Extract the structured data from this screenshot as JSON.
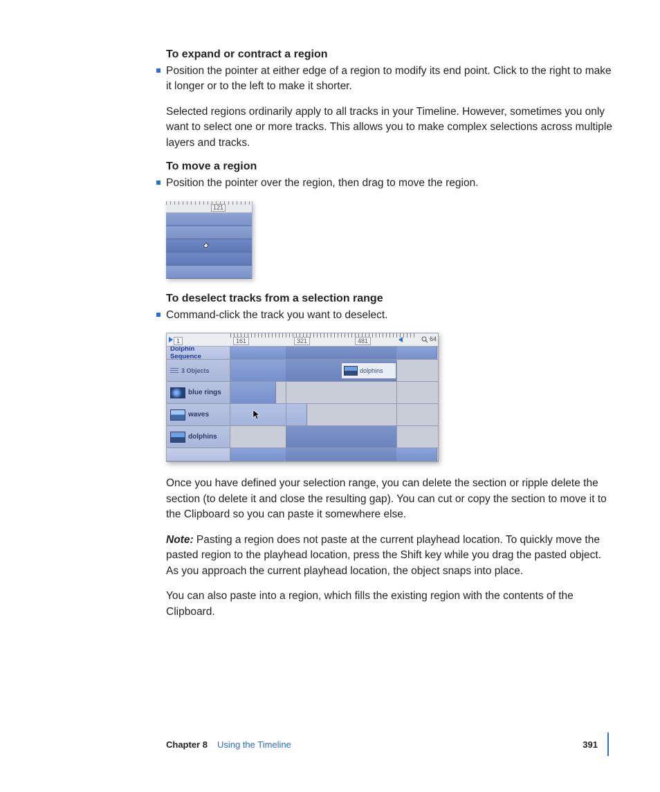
{
  "section1": {
    "heading": "To expand or contract a region",
    "bullet": "Position the pointer at either edge of a region to modify its end point. Click to the right to make it longer or to the left to make it shorter.",
    "para": "Selected regions ordinarily apply to all tracks in your Timeline. However, sometimes you only want to select one or more tracks. This allows you to make complex selections across multiple layers and tracks."
  },
  "section2": {
    "heading": "To move a region",
    "bullet": "Position the pointer over the region, then drag to move the region."
  },
  "fig1": {
    "ruler_label": "121"
  },
  "section3": {
    "heading": "To deselect tracks from a selection range",
    "bullet": "Command-click the track you want to deselect."
  },
  "fig2": {
    "ruler": {
      "l0": "1",
      "l1": "161",
      "l2": "321",
      "l3": "481",
      "end": "64"
    },
    "header": "Dolphin Sequence",
    "subheader": "3 Objects",
    "tracks": {
      "t1": "blue rings",
      "t2": "waves",
      "t3": "dolphins"
    },
    "clip_label": "dolphins"
  },
  "after_fig_para1": "Once you have defined your selection range, you can delete the section or ripple delete the section (to delete it and close the resulting gap). You can cut or copy the section to move it to the Clipboard so you can paste it somewhere else.",
  "note": {
    "label": "Note:",
    "text": "  Pasting a region does not paste at the current playhead location. To quickly move the pasted region to the playhead location, press the Shift key while you drag the pasted object. As you approach the current playhead location, the object snaps into place."
  },
  "after_fig_para2": "You can also paste into a region, which fills the existing region with the contents of the Clipboard.",
  "footer": {
    "chapter": "Chapter 8",
    "title": "Using the Timeline",
    "page": "391"
  }
}
